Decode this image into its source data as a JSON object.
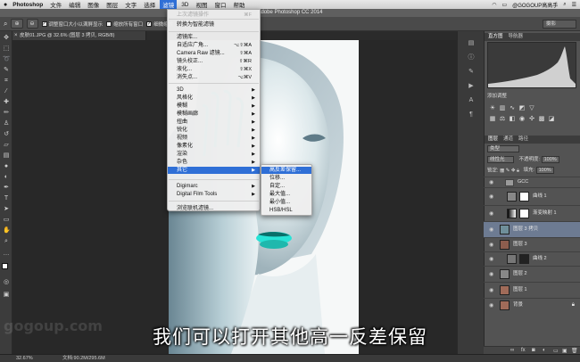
{
  "menubar": {
    "app": "Photoshop",
    "items": [
      "文件",
      "编辑",
      "图像",
      "图层",
      "文字",
      "选择",
      "滤镜",
      "3D",
      "视图",
      "窗口",
      "帮助"
    ],
    "active_index": 6,
    "right_text": "@GOGOUP高高手"
  },
  "titlebar": {
    "title": "Adobe Photoshop CC 2014"
  },
  "options": {
    "checkbox_resize": "调整窗口大小以满屏显示",
    "checkbox_all": "缩放所有窗口",
    "checkbox_scrub": "细微缩放",
    "workspace": "摄影"
  },
  "doc_tab": {
    "label": "皮肤01.JPG @ 32.6% (图层 3 拷贝, RGB/8)",
    "close": "×"
  },
  "filter_menu": {
    "items": [
      {
        "label": "上次滤镜操作",
        "shortcut": "⌘F",
        "disabled": true
      },
      {
        "label": "转换为智能滤镜"
      },
      {
        "label": "滤镜库..."
      },
      {
        "label": "自适应广角...",
        "shortcut": "⌥⇧⌘A"
      },
      {
        "label": "Camera Raw 滤镜...",
        "shortcut": "⇧⌘A"
      },
      {
        "label": "镜头校正...",
        "shortcut": "⇧⌘R"
      },
      {
        "label": "液化...",
        "shortcut": "⇧⌘X"
      },
      {
        "label": "消失点...",
        "shortcut": "⌥⌘V"
      },
      {
        "label": "3D",
        "sub": true
      },
      {
        "label": "风格化",
        "sub": true
      },
      {
        "label": "模糊",
        "sub": true
      },
      {
        "label": "模糊画廊",
        "sub": true
      },
      {
        "label": "扭曲",
        "sub": true
      },
      {
        "label": "锐化",
        "sub": true
      },
      {
        "label": "视频",
        "sub": true
      },
      {
        "label": "像素化",
        "sub": true
      },
      {
        "label": "渲染",
        "sub": true
      },
      {
        "label": "杂色",
        "sub": true
      },
      {
        "label": "其它",
        "sub": true,
        "highlight": true
      },
      {
        "label": "Digimarc",
        "sub": true
      },
      {
        "label": "Digital Film Tools",
        "sub": true
      },
      {
        "label": "浏览联机滤镜..."
      }
    ]
  },
  "submenu": {
    "items": [
      "高反差保留...",
      "位移...",
      "自定...",
      "最大值...",
      "最小值...",
      "HSB/HSL"
    ],
    "highlight_index": 0
  },
  "panels": {
    "histogram_tabs": [
      "直方图",
      "导航器"
    ],
    "adjust_title": "添加调整",
    "layer_tabs": [
      "图层",
      "通道",
      "路径"
    ],
    "kind": "类型",
    "blend": "线性光",
    "opacity_label": "不透明度:",
    "opacity": "100%",
    "lock_label": "锁定:",
    "fill_label": "填充:",
    "fill": "100%",
    "layers": [
      {
        "name": "GCC",
        "type": "group"
      },
      {
        "name": "曲线 1",
        "type": "adjust"
      },
      {
        "name": "渐变映射 1",
        "type": "adjust"
      },
      {
        "name": "图层 3 拷贝",
        "type": "pixel",
        "selected": true
      },
      {
        "name": "图层 3",
        "type": "pixel"
      },
      {
        "name": "曲线 2",
        "type": "adjust"
      },
      {
        "name": "图层 2",
        "type": "pixel"
      },
      {
        "name": "图层 1",
        "type": "pixel"
      },
      {
        "name": "背景",
        "type": "pixel"
      }
    ]
  },
  "status": {
    "zoom": "32.67%",
    "doc": "文档:90.2M/295.6M"
  },
  "subtitle": "我们可以打开其他高一反差保留",
  "watermark": "gogoup.com"
}
